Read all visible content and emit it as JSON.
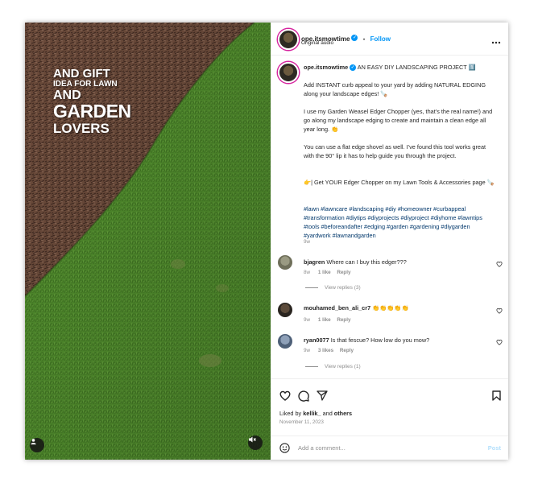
{
  "media": {
    "overlay": {
      "line1": "AND GIFT",
      "line2": "IDEA FOR LAWN",
      "line3": "AND",
      "line4": "GARDEN",
      "line5": "LOVERS"
    },
    "icons": {
      "user": "user-icon",
      "mute": "speaker-muted-icon"
    }
  },
  "header": {
    "username": "ope.itsmowtime",
    "dot": "•",
    "follow": "Follow",
    "audio": "Original audio",
    "more": "more-options-icon"
  },
  "caption": {
    "username": "ope.itsmowtime",
    "title": "AN EASY DIY LANDSCAPING PROJECT 1️⃣",
    "p1": "Add INSTANT curb appeal to your yard by adding NATURAL EDGING along your landscape edges! 🪚",
    "p2": "I use my Garden Weasel Edger Chopper (yes, that’s the real name!) and go along my landscape edging to create and maintain a clean edge all year long. 👏",
    "p3": "You can use a flat edge shovel as well. I’ve found this tool works great with the 90° lip it has to help guide you through the project.",
    "p4": "👉| Get YOUR Edger Chopper on my Lawn Tools & Accessories page 🪚",
    "tags": "#lawn #lawncare #landscaping #diy #homeowner #curbappeal #transformation #diytips #diyprojects #diyproject #diyhome #lawntips #tools #beforeandafter #edging #garden #gardening #diygarden #yardwork #lawnandgarden",
    "age": "9w"
  },
  "comments": [
    {
      "user": "bjagren",
      "text": "Where can I buy this edger???",
      "age": "8w",
      "likes": "1 like",
      "reply": "Reply",
      "view_replies": "View replies (3)"
    },
    {
      "user": "mouhamed_ben_ali_cr7",
      "text": "👏👏👏👏👏",
      "age": "9w",
      "likes": "1 like",
      "reply": "Reply"
    },
    {
      "user": "ryan0077",
      "text": "Is that fescue? How low do you mow?",
      "age": "9w",
      "likes": "3 likes",
      "reply": "Reply",
      "view_replies": "View replies (1)"
    }
  ],
  "actions": {
    "liked_by_prefix": "Liked by ",
    "liked_by_user": "kellik_",
    "liked_by_mid": " and ",
    "liked_by_others": "others",
    "date": "November 11, 2023"
  },
  "add_comment": {
    "placeholder": "Add a comment...",
    "post": "Post"
  },
  "colors": {
    "accent": "#0095f6",
    "text": "#262626",
    "muted": "#8e8e8e",
    "hashtag": "#00376b"
  }
}
